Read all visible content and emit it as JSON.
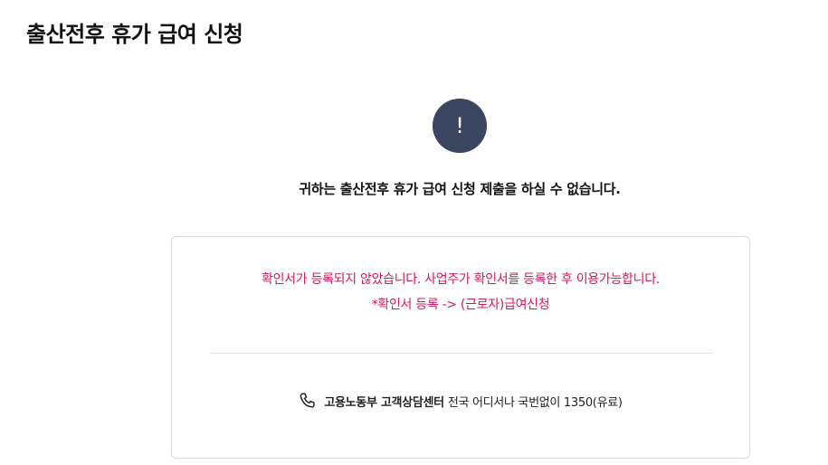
{
  "page": {
    "title": "출산전후 휴가 급여 신청"
  },
  "alert": {
    "icon": "exclamation-icon",
    "mark": "!",
    "circle_color": "#3a4560",
    "message": "귀하는 출산전후 휴가 급여 신청 제출을 하실 수 없습니다."
  },
  "notice": {
    "color": "#d5195a",
    "line1": "확인서가 등록되지 않았습니다. 사업주가 확인서를 등록한 후 이용가능합니다.",
    "line2": "*확인서 등록 -> (근로자)급여신청"
  },
  "contact": {
    "icon": "phone-icon",
    "name": "고용노동부 고객상담센터",
    "detail": "전국 어디서나 국번없이 1350(유료)"
  }
}
